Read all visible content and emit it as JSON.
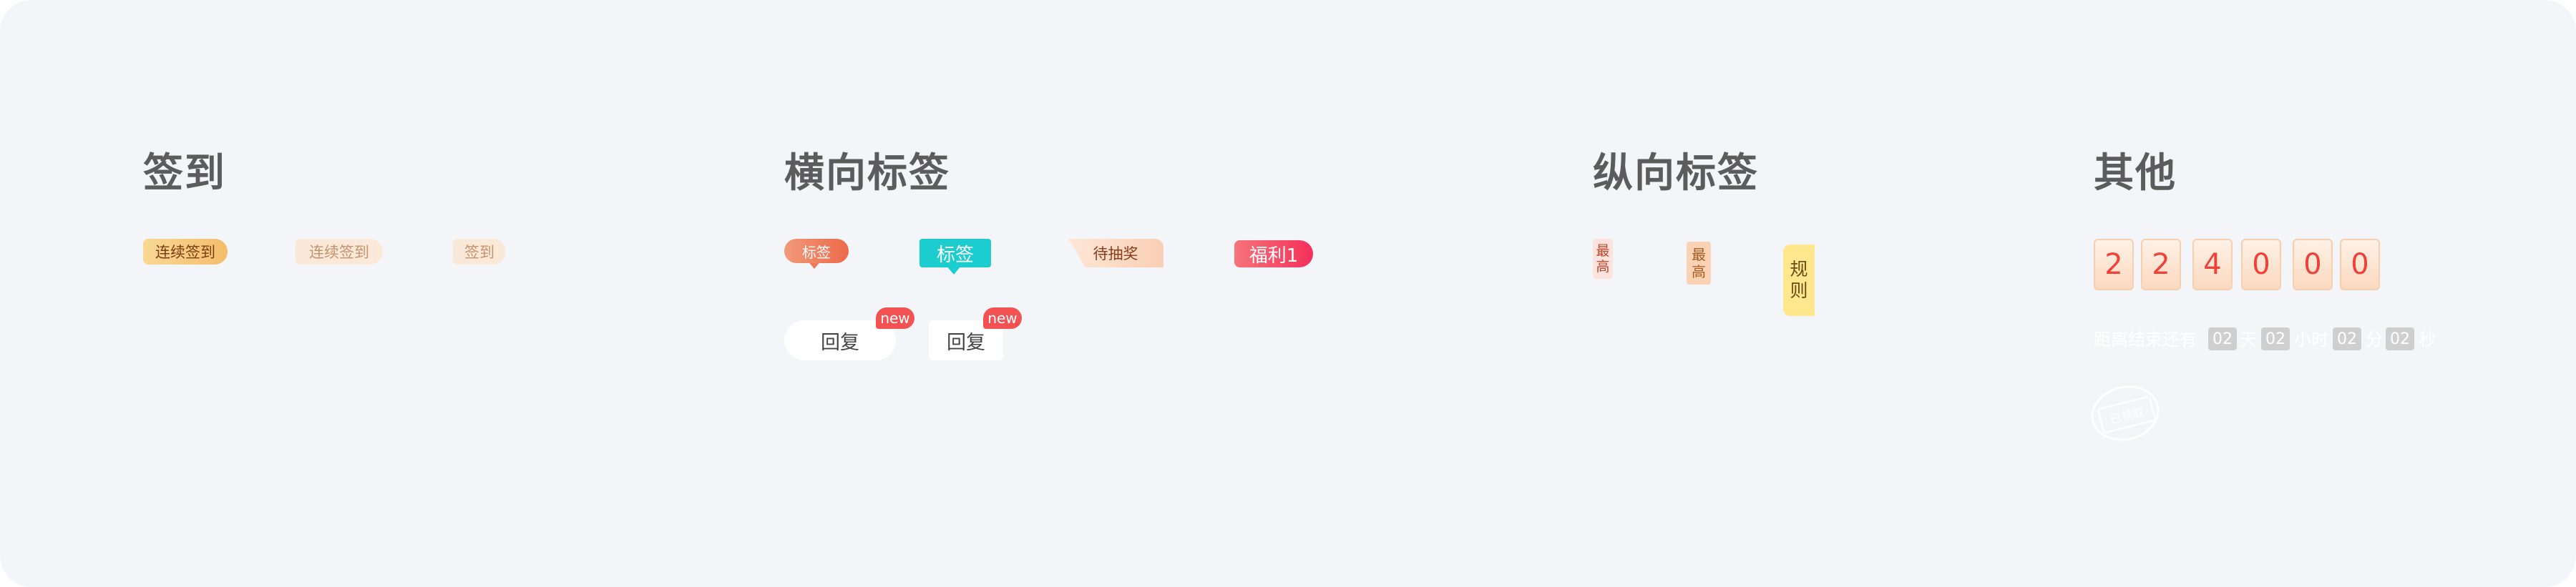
{
  "sections": {
    "sign": {
      "title": "签到"
    },
    "horizontal": {
      "title": "横向标签"
    },
    "vertical": {
      "title": "纵向标签"
    },
    "other": {
      "title": "其他"
    }
  },
  "sign_tags": [
    "连续签到",
    "连续签到",
    "签到"
  ],
  "horizontal_tags": {
    "tag1": "标签",
    "tag2": "标签",
    "tag3": "待抽奖",
    "tag4": "福利1",
    "reply1": "回复",
    "reply1_badge": "new",
    "reply2": "回复",
    "reply2_badge": "new"
  },
  "vertical_tags": {
    "v1": [
      "最",
      "高"
    ],
    "v2": [
      "最",
      "高"
    ],
    "v3": [
      "规",
      "则"
    ]
  },
  "other": {
    "digits": [
      "2",
      "2",
      "4",
      "0",
      "0",
      "0"
    ],
    "countdown": {
      "label": "距离结束还有",
      "d": "02",
      "sep1": "天",
      "h": "02",
      "sep2": "小时",
      "m": "02",
      "sep3": "分",
      "s": "02",
      "sep4": "秒"
    },
    "stamp": "已领取"
  },
  "colors": {
    "background": "#f4f5f9",
    "title": "#5c5c5c",
    "accent_red": "#ef4138",
    "teal": "#1ccdd0",
    "new_badge": "#f25252"
  }
}
